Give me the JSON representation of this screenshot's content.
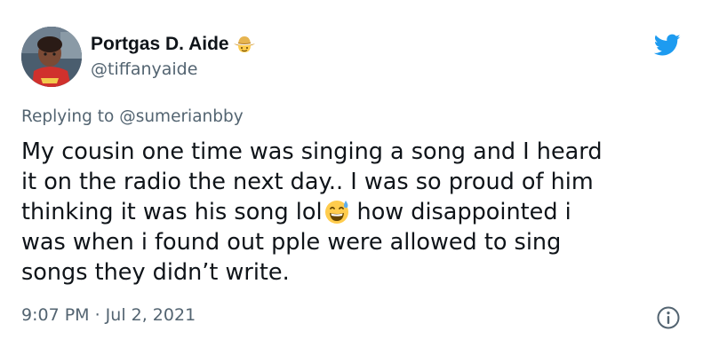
{
  "tweet": {
    "author": {
      "display_name": "Portgas D. Aide",
      "name_emoji": "face-with-cowboy-hat-emoji",
      "handle": "@tiffanyaide",
      "avatar": "profile-photo"
    },
    "platform_icon": "twitter-bird-icon",
    "replying_prefix": "Replying to ",
    "replying_to": "@sumerianbby",
    "text_lines": [
      "My cousin one time was singing a song and I heard",
      "it on the radio the next day.. I was so proud of him",
      "thinking it was his song lol",
      "how disappointed i",
      "was when i found out pple were allowed to sing",
      "songs they didn’t write."
    ],
    "inline_emoji": "grinning-face-with-sweat-emoji",
    "timestamp": "9:07 PM · Jul 2, 2021",
    "info_icon": "info-icon"
  },
  "colors": {
    "text_primary": "#0f1419",
    "text_secondary": "#536471",
    "twitter_blue": "#1d9bf0",
    "background": "#ffffff"
  }
}
